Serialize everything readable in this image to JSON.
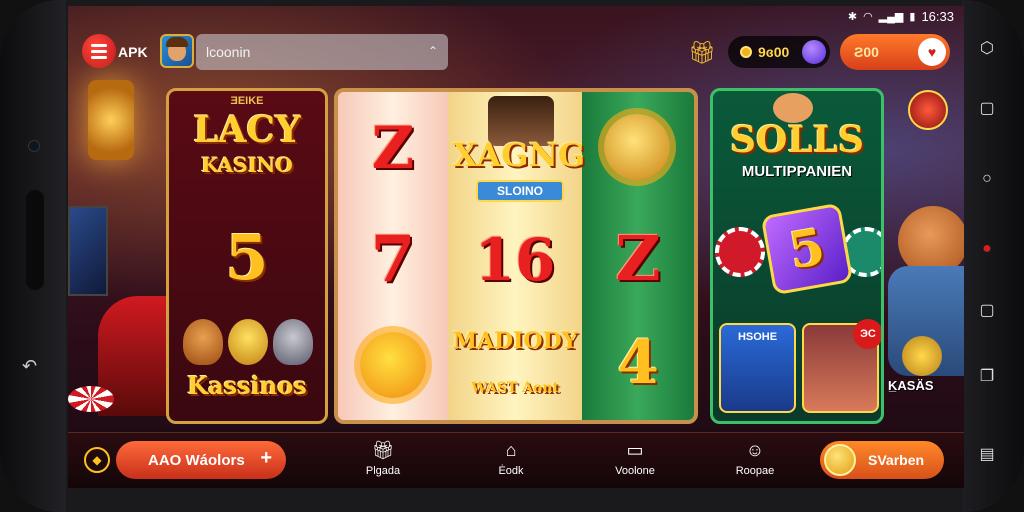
{
  "status_bar": {
    "time": "16:33",
    "icons": [
      "bluetooth-icon",
      "wifi-icon",
      "signal-icon",
      "battery-icon"
    ]
  },
  "top_bar": {
    "apk_label": "APK",
    "search_value": "lcoonin",
    "coins_value": "9ɞ00",
    "deposit_value": "Ƨ00"
  },
  "games": {
    "left": {
      "tag": "ƎEIKE",
      "title": "LACY",
      "subtitle": "KASINO",
      "number": "5",
      "footer": "Kassinos"
    },
    "middle": {
      "title": "XAGNG",
      "subtitle": "SLOINO",
      "reel1": [
        "Z",
        "7"
      ],
      "reel2": [
        "16",
        "MADIODY",
        "WAST Aont"
      ],
      "reel3": [
        "Z",
        "4"
      ]
    },
    "right": {
      "title": "SOLLS",
      "subtitle": "MULTIPPANIEN",
      "dice": "5",
      "thumb1": "HSOHE",
      "badge": "ЭС"
    }
  },
  "deco": {
    "label": "K̲ASÄS"
  },
  "bottom_bar": {
    "left_button": "AAO Wáolors",
    "nav": [
      {
        "label": "Plgada",
        "icon": "gift-icon"
      },
      {
        "label": "Ėodk",
        "icon": "home-icon"
      },
      {
        "label": "Voolone",
        "icon": "chat-icon"
      },
      {
        "label": "Roopae",
        "icon": "user-icon"
      }
    ],
    "right_button": "SVarben"
  },
  "colors": {
    "accent": "#ff6a3a",
    "gold": "#ffc020",
    "panel_green": "#3ec06a"
  }
}
